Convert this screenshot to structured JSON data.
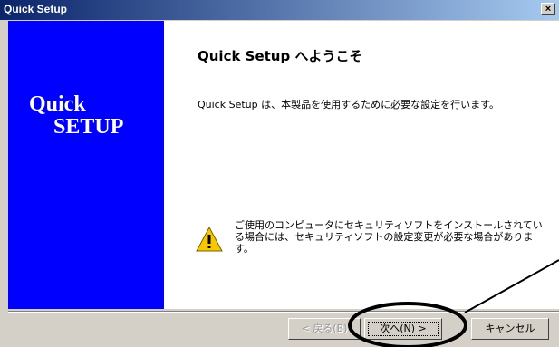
{
  "window": {
    "title": "Quick Setup",
    "close_symbol": "×"
  },
  "banner": {
    "line1": "Quick",
    "line2": "SETUP",
    "background_color": "#0000ff"
  },
  "content": {
    "heading": "Quick Setup へようこそ",
    "description": "Quick Setup は、本製品を使用するために必要な設定を行います。",
    "warning_icon": "warning-icon",
    "warning_text": "ご使用のコンピュータにセキュリティソフトをインストールされている場合には、セキュリティソフトの設定変更が必要な場合があります。"
  },
  "buttons": {
    "back_label": "< 戻る(B)",
    "next_label": "次へ(N) >",
    "cancel_label": "キャンセル"
  },
  "colors": {
    "titlebar_start": "#0a246a",
    "titlebar_end": "#a6caf0",
    "annotation": "#000000"
  }
}
